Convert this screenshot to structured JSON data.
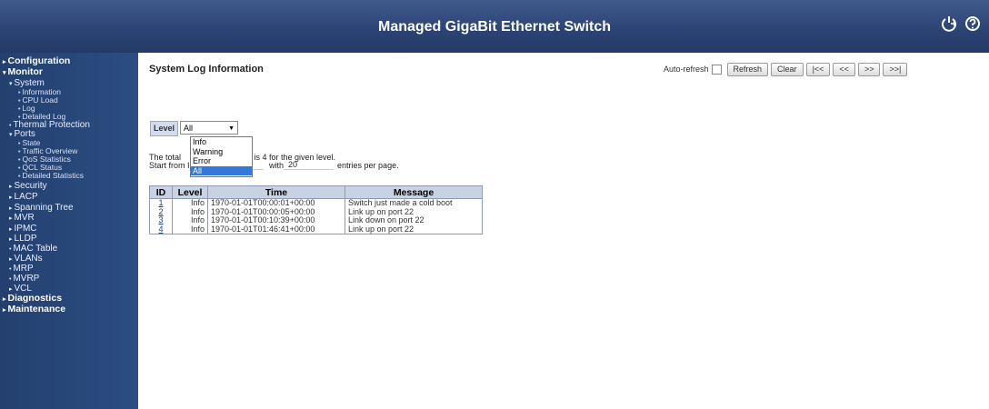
{
  "header": {
    "title": "Managed GigaBit Ethernet Switch"
  },
  "sidebar": {
    "items": [
      {
        "label": "Configuration",
        "arrow": "▸"
      },
      {
        "label": "Monitor",
        "arrow": "▾"
      },
      {
        "label": "System",
        "arrow": "▾"
      },
      {
        "label": "Information",
        "arrow": "•"
      },
      {
        "label": "CPU Load",
        "arrow": "•"
      },
      {
        "label": "Log",
        "arrow": "•"
      },
      {
        "label": "Detailed Log",
        "arrow": "•"
      },
      {
        "label": "Thermal Protection",
        "arrow": "•"
      },
      {
        "label": "Ports",
        "arrow": "▾"
      },
      {
        "label": "State",
        "arrow": "•"
      },
      {
        "label": "Traffic Overview",
        "arrow": "•"
      },
      {
        "label": "QoS Statistics",
        "arrow": "•"
      },
      {
        "label": "QCL Status",
        "arrow": "•"
      },
      {
        "label": "Detailed Statistics",
        "arrow": "•"
      },
      {
        "label": "Security",
        "arrow": "▸"
      },
      {
        "label": "LACP",
        "arrow": "▸"
      },
      {
        "label": "Spanning Tree",
        "arrow": "▸"
      },
      {
        "label": "MVR",
        "arrow": "▸"
      },
      {
        "label": "IPMC",
        "arrow": "▸"
      },
      {
        "label": "LLDP",
        "arrow": "▸"
      },
      {
        "label": "MAC Table",
        "arrow": "•"
      },
      {
        "label": "VLANs",
        "arrow": "▸"
      },
      {
        "label": "MRP",
        "arrow": "•"
      },
      {
        "label": "MVRP",
        "arrow": "•"
      },
      {
        "label": "VCL",
        "arrow": "▸"
      },
      {
        "label": "Diagnostics",
        "arrow": "▸"
      },
      {
        "label": "Maintenance",
        "arrow": "▸"
      }
    ]
  },
  "main": {
    "title": "System Log Information",
    "toolbar": {
      "auto_refresh_label": "Auto-refresh",
      "refresh": "Refresh",
      "clear": "Clear",
      "first": "|<<",
      "prev": "<<",
      "next": ">>",
      "last": ">>|"
    },
    "level_label": "Level",
    "level_value": "All",
    "level_options": [
      "Info",
      "Warning",
      "Error",
      "All"
    ],
    "total_text_pre": "The total",
    "total_text_post": "ntries is 4 for the given level.",
    "start_from_label": "Start from ID",
    "start_id": "1",
    "with_label": "with",
    "per_page": "20",
    "entries_label": "entries per page.",
    "table": {
      "headers": [
        "ID",
        "Level",
        "Time",
        "Message"
      ],
      "rows": [
        {
          "id": "1",
          "level": "Info",
          "time": "1970-01-01T00:00:01+00:00",
          "message": "Switch just made a cold boot"
        },
        {
          "id": "2",
          "level": "Info",
          "time": "1970-01-01T00:00:05+00:00",
          "message": "Link up on port 22"
        },
        {
          "id": "3",
          "level": "Info",
          "time": "1970-01-01T00:10:39+00:00",
          "message": "Link down on port 22"
        },
        {
          "id": "4",
          "level": "Info",
          "time": "1970-01-01T01:46:41+00:00",
          "message": "Link up on port 22"
        }
      ]
    }
  },
  "colors": {
    "header_bg": "#2b4373",
    "sidebar_bg": "#284877",
    "table_header_bg": "#c9d2e3",
    "selected_option": "#3478d8"
  },
  "icons": {
    "logout": "logout-icon",
    "help": "help-icon"
  }
}
